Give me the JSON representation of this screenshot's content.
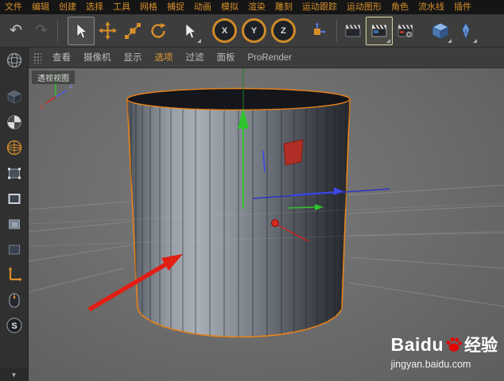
{
  "menubar": {
    "items": [
      "文件",
      "编辑",
      "创建",
      "选择",
      "工具",
      "网格",
      "捕捉",
      "动画",
      "模拟",
      "渲染",
      "雕刻",
      "运动跟踪",
      "运动图形",
      "角色",
      "流水线",
      "插件"
    ]
  },
  "toolbar": {
    "undo_glyph": "↶",
    "redo_glyph": "↷",
    "axis_x": "X",
    "axis_y": "Y",
    "axis_z": "Z"
  },
  "viewport_menu": {
    "items": [
      "查看",
      "摄像机",
      "显示",
      "选项",
      "过滤",
      "面板",
      "ProRender"
    ],
    "active_item": "选项"
  },
  "viewport": {
    "label": "透视视图",
    "axis_x": "X",
    "axis_y": "Y",
    "axis_z": "Z"
  },
  "palette": {
    "snap_letter": "S",
    "scroll_down_glyph": "▼"
  },
  "watermark": {
    "brand": "Baidu",
    "suffix": "经验",
    "url": "jingyan.baidu.com"
  },
  "colors": {
    "accent_orange": "#d88f2a",
    "selection_outline": "#e8831a",
    "axis_green": "#2ec32e",
    "axis_red": "#d42a1e",
    "axis_blue": "#3a48e8",
    "annotation_red": "#e31e14",
    "baidu_red": "#e10601"
  }
}
